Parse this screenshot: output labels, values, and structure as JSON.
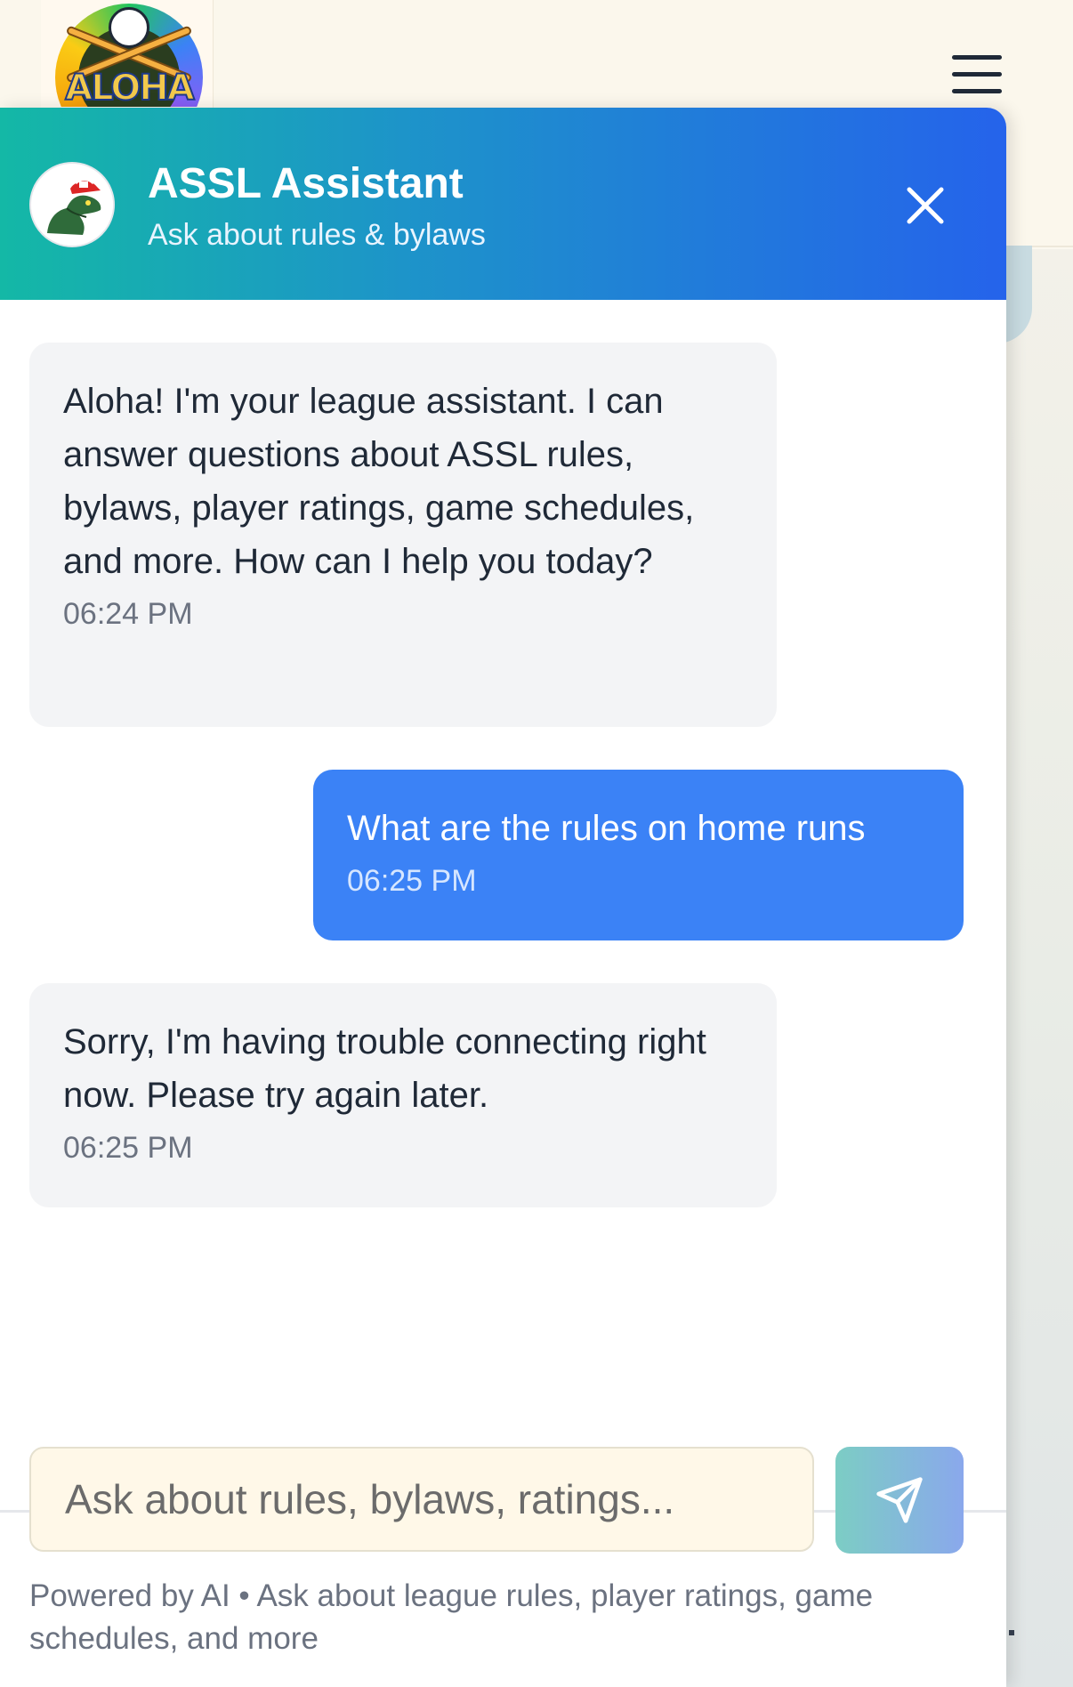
{
  "site": {
    "logo_text": "ALOHA STATE"
  },
  "chat": {
    "title": "ASSL Assistant",
    "subtitle": "Ask about rules & bylaws",
    "messages": [
      {
        "role": "assistant",
        "text": "Aloha! I'm your league assistant. I can answer questions about ASSL rules, bylaws, player ratings, game schedules, and more. How can I help you today?",
        "time": "06:24 PM"
      },
      {
        "role": "user",
        "text": "What are the rules on home runs",
        "time": "06:25 PM"
      },
      {
        "role": "assistant",
        "text": "Sorry, I'm having trouble connecting right now. Please try again later.",
        "time": "06:25 PM"
      }
    ],
    "input": {
      "placeholder": "Ask about rules, bylaws, ratings...",
      "value": ""
    },
    "footer": "Powered by AI • Ask about league rules, player ratings, game schedules, and more"
  },
  "icons": {
    "menu": "hamburger-menu-icon",
    "close": "close-icon",
    "send": "send-paper-plane-icon",
    "avatar": "dinosaur-mascot-avatar"
  },
  "colors": {
    "header_gradient_start": "#14b8a6",
    "header_gradient_end": "#2563eb",
    "user_bubble": "#3b82f6",
    "bot_bubble": "#f3f4f6",
    "input_bg": "#fff8e8"
  }
}
